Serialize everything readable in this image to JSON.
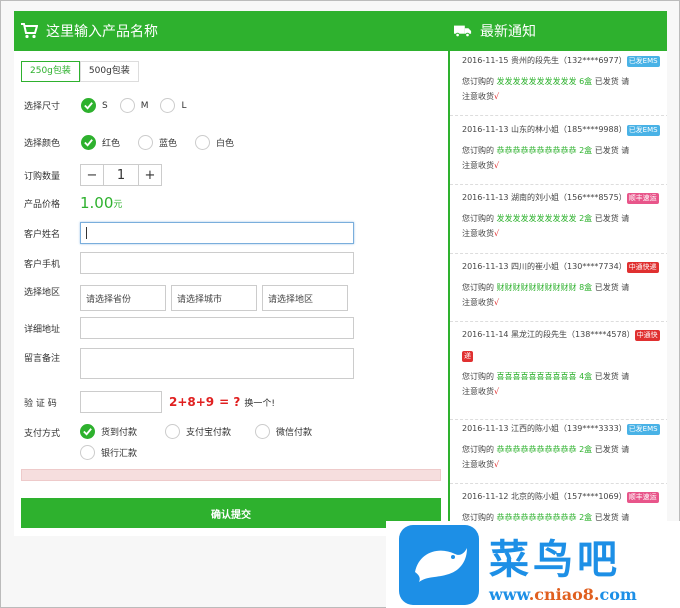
{
  "product": {
    "title": "这里输入产品名称",
    "tabs": [
      "250g包装",
      "500g包装"
    ],
    "size_label": "选择尺寸",
    "sizes": [
      "S",
      "M",
      "L"
    ],
    "color_label": "选择颜色",
    "colors": [
      "红色",
      "蓝色",
      "白色"
    ],
    "qty_label": "订购数量",
    "qty_minus": "−",
    "qty_value": "1",
    "qty_plus": "+",
    "price_label": "产品价格",
    "price_value": "1.00",
    "price_unit": "元",
    "name_label": "客户姓名",
    "name_value": "",
    "phone_label": "客户手机",
    "region_label": "选择地区",
    "province": "请选择省份",
    "city": "请选择城市",
    "district": "请选择地区",
    "address_label": "详细地址",
    "note_label": "留言备注",
    "captcha_label": "验 证 码",
    "captcha_expr": "2+8+9",
    "captcha_eq": "= ?",
    "captcha_refresh": "换一个!",
    "pay_label": "支付方式",
    "pay_options": [
      "货到付款",
      "支付宝付款",
      "微信付款",
      "银行汇款"
    ],
    "submit": "确认提交"
  },
  "news": {
    "title": "最新通知",
    "items": [
      {
        "date": "2016-11-15",
        "who": "贵州的段先生（132****6977）",
        "badge": "已发EMS",
        "badge_color": "#49b2e6",
        "l2a": "您订购的",
        "prod": "发发发发发发发发发发",
        "qty": "6盒",
        "l2b": "已发货 请",
        "l3": "注意收货",
        "tick": "√"
      },
      {
        "date": "2016-11-13",
        "who": "山东的林小姐（185****9988）",
        "badge": "已发EMS",
        "badge_color": "#49b2e6",
        "l2a": "您订购的",
        "prod": "恭恭恭恭恭恭恭恭恭恭",
        "qty": "2盒",
        "l2b": "已发货 请",
        "l3": "注意收货",
        "tick": "√"
      },
      {
        "date": "2016-11-13",
        "who": "湖南的刘小姐（156****8575）",
        "badge": "顺丰速运",
        "badge_color": "#e8558a",
        "l2a": "您订购的",
        "prod": "发发发发发发发发发发",
        "qty": "2盒",
        "l2b": "已发货 请",
        "l3": "注意收货",
        "tick": "√"
      },
      {
        "date": "2016-11-13",
        "who": "四川的崔小姐（130****7734）",
        "badge": "中通快递",
        "badge_color": "#e03030",
        "l2a": "您订购的",
        "prod": "财财财财财财财财财财",
        "qty": "8盒",
        "l2b": "已发货 请",
        "l3": "注意收货",
        "tick": "√"
      },
      {
        "date": "2016-11-14",
        "who": "黑龙江的段先生（138****4578）",
        "badge": "中通快",
        "badge2": "递",
        "badge_color": "#e03030",
        "l2a": "您订购的",
        "prod": "喜喜喜喜喜喜喜喜喜喜",
        "qty": "4盒",
        "l2b": "已发货 请",
        "l3": "注意收货",
        "tick": "√"
      },
      {
        "date": "2016-11-13",
        "who": "江西的陈小姐（139****3333）",
        "badge": "已发EMS",
        "badge_color": "#49b2e6",
        "l2a": "您订购的",
        "prod": "恭恭恭恭恭恭恭恭恭恭",
        "qty": "2盒",
        "l2b": "已发货 请",
        "l3": "注意收货",
        "tick": "√"
      },
      {
        "date": "2016-11-12",
        "who": "北京的陈小姐（157****1069）",
        "badge": "顺丰速运",
        "badge_color": "#e8558a",
        "l2a": "您订购的",
        "prod": "恭恭恭恭恭恭恭恭恭恭",
        "qty": "2盒",
        "l2b": "已发货 请",
        "l3": "",
        "tick": ""
      }
    ]
  },
  "watermark": {
    "name": "菜鸟吧",
    "url_a": "www",
    "url_b": ".cniao8.",
    "url_c": "com"
  },
  "colors": {
    "accent": "#2eb12e",
    "brand": "#1d8fe6"
  }
}
